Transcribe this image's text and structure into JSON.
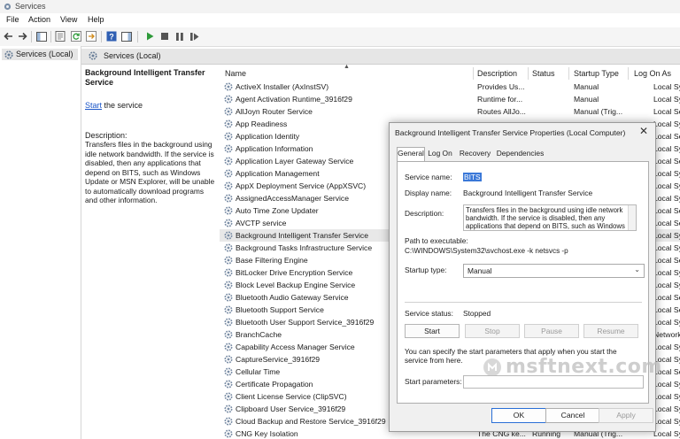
{
  "window": {
    "title": "Services"
  },
  "menu": [
    "File",
    "Action",
    "View",
    "Help"
  ],
  "tree": {
    "root_label": "Services (Local)"
  },
  "main": {
    "header_label": "Services (Local)"
  },
  "details": {
    "service_name": "Background Intelligent Transfer Service",
    "start_link": "Start",
    "start_suffix": " the service",
    "description_label": "Description:",
    "description": "Transfers files in the background using idle network bandwidth. If the service is disabled, then any applications that depend on BITS, such as Windows Update or MSN Explorer, will be unable to automatically download programs and other information."
  },
  "columns": {
    "name": "Name",
    "description": "Description",
    "status": "Status",
    "startup_type": "Startup Type",
    "log_on_as": "Log On As"
  },
  "services": [
    {
      "name": "ActiveX Installer (AxInstSV)",
      "description": "Provides Us...",
      "status": "",
      "startup": "Manual",
      "logon": "Local Syste..."
    },
    {
      "name": "Agent Activation Runtime_3916f29",
      "description": "Runtime for...",
      "status": "",
      "startup": "Manual",
      "logon": "Local Syste..."
    },
    {
      "name": "AllJoyn Router Service",
      "description": "Routes AllJo...",
      "status": "",
      "startup": "Manual (Trig...",
      "logon": "Local Service"
    },
    {
      "name": "App Readiness",
      "description": "",
      "status": "",
      "startup": "",
      "logon": "Local Syste..."
    },
    {
      "name": "Application Identity",
      "description": "",
      "status": "",
      "startup": "",
      "logon": "Local Service"
    },
    {
      "name": "Application Information",
      "description": "",
      "status": "",
      "startup": "",
      "logon": "Local Syste..."
    },
    {
      "name": "Application Layer Gateway Service",
      "description": "",
      "status": "",
      "startup": "",
      "logon": "Local Service"
    },
    {
      "name": "Application Management",
      "description": "",
      "status": "",
      "startup": "",
      "logon": "Local Syste..."
    },
    {
      "name": "AppX Deployment Service (AppXSVC)",
      "description": "",
      "status": "",
      "startup": "",
      "logon": "Local Syste..."
    },
    {
      "name": "AssignedAccessManager Service",
      "description": "",
      "status": "",
      "startup": "",
      "logon": "Local Syste..."
    },
    {
      "name": "Auto Time Zone Updater",
      "description": "",
      "status": "",
      "startup": "",
      "logon": "Local Service"
    },
    {
      "name": "AVCTP service",
      "description": "",
      "status": "",
      "startup": "",
      "logon": "Local Service"
    },
    {
      "name": "Background Intelligent Transfer Service",
      "description": "",
      "status": "",
      "startup": "",
      "logon": "Local Syste..."
    },
    {
      "name": "Background Tasks Infrastructure Service",
      "description": "",
      "status": "",
      "startup": "",
      "logon": "Local Syste..."
    },
    {
      "name": "Base Filtering Engine",
      "description": "",
      "status": "",
      "startup": "",
      "logon": "Local Service"
    },
    {
      "name": "BitLocker Drive Encryption Service",
      "description": "",
      "status": "",
      "startup": "",
      "logon": "Local Syste..."
    },
    {
      "name": "Block Level Backup Engine Service",
      "description": "",
      "status": "",
      "startup": "",
      "logon": "Local Syste..."
    },
    {
      "name": "Bluetooth Audio Gateway Service",
      "description": "",
      "status": "",
      "startup": "",
      "logon": "Local Service"
    },
    {
      "name": "Bluetooth Support Service",
      "description": "",
      "status": "",
      "startup": "",
      "logon": "Local Service"
    },
    {
      "name": "Bluetooth User Support Service_3916f29",
      "description": "",
      "status": "",
      "startup": "",
      "logon": "Local Syste..."
    },
    {
      "name": "BranchCache",
      "description": "",
      "status": "",
      "startup": "",
      "logon": "Network S..."
    },
    {
      "name": "Capability Access Manager Service",
      "description": "",
      "status": "",
      "startup": "",
      "logon": "Local Syste..."
    },
    {
      "name": "CaptureService_3916f29",
      "description": "",
      "status": "",
      "startup": "",
      "logon": "Local Syste..."
    },
    {
      "name": "Cellular Time",
      "description": "",
      "status": "",
      "startup": "",
      "logon": "Local Service"
    },
    {
      "name": "Certificate Propagation",
      "description": "",
      "status": "",
      "startup": "",
      "logon": "Local Syste..."
    },
    {
      "name": "Client License Service (ClipSVC)",
      "description": "",
      "status": "",
      "startup": "",
      "logon": "Local Syste..."
    },
    {
      "name": "Clipboard User Service_3916f29",
      "description": "",
      "status": "",
      "startup": "",
      "logon": "Local Syste..."
    },
    {
      "name": "Cloud Backup and Restore Service_3916f29",
      "description": "",
      "status": "",
      "startup": "",
      "logon": "Local Syste..."
    },
    {
      "name": "CNG Key Isolation",
      "description": "The CNG ke...",
      "status": "Running",
      "startup": "Manual (Trig...",
      "logon": "Local Syste..."
    }
  ],
  "selected_index": 12,
  "dialog": {
    "title": "Background Intelligent Transfer Service Properties (Local Computer)",
    "tabs": [
      "General",
      "Log On",
      "Recovery",
      "Dependencies"
    ],
    "service_name_label": "Service name:",
    "service_name": "BITS",
    "display_name_label": "Display name:",
    "display_name": "Background Intelligent Transfer Service",
    "description_label": "Description:",
    "description": "Transfers files in the background using idle network bandwidth. If the service is disabled, then any applications that depend on BITS, such as Windows",
    "path_label": "Path to executable:",
    "path": "C:\\WINDOWS\\System32\\svchost.exe -k netsvcs -p",
    "startup_label": "Startup type:",
    "startup_value": "Manual",
    "status_label": "Service status:",
    "status_value": "Stopped",
    "btn_start": "Start",
    "btn_stop": "Stop",
    "btn_pause": "Pause",
    "btn_resume": "Resume",
    "info": "You can specify the start parameters that apply when you start the service from here.",
    "params_label": "Start parameters:",
    "btn_ok": "OK",
    "btn_cancel": "Cancel",
    "btn_apply": "Apply"
  },
  "watermark": {
    "text": "msftnext.com"
  }
}
